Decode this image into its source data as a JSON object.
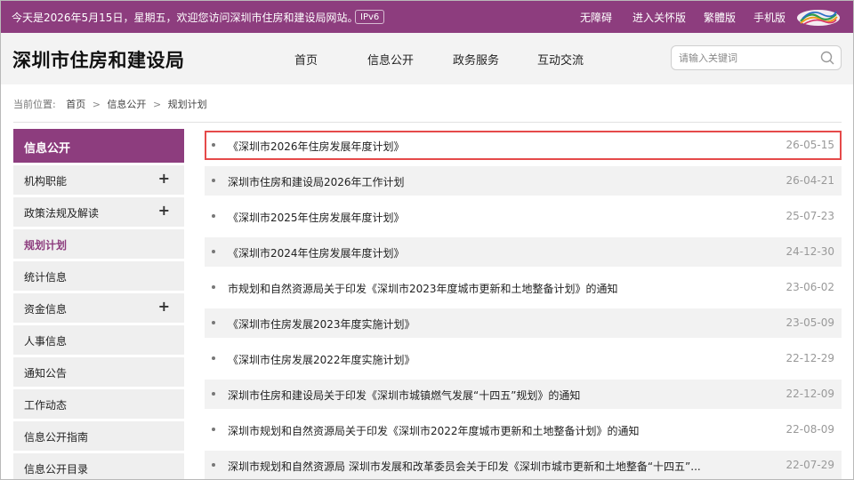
{
  "topbar": {
    "welcome": "今天是2026年5月15日，星期五，欢迎您访问深圳市住房和建设局网站。",
    "ipv6": "IPv6",
    "links": [
      "无障碍",
      "进入关怀版",
      "繁體版",
      "手机版"
    ]
  },
  "header": {
    "site_title": "深圳市住房和建设局",
    "nav": [
      "首页",
      "信息公开",
      "政务服务",
      "互动交流"
    ],
    "search_placeholder": "请输入关键词"
  },
  "breadcrumb": {
    "prefix": "当前位置:",
    "items": [
      "首页",
      "信息公开",
      "规划计划"
    ]
  },
  "sidebar": {
    "header": "信息公开",
    "items": [
      {
        "label": "机构职能",
        "expandable": true,
        "expand": "+"
      },
      {
        "label": "政策法规及解读",
        "expandable": true,
        "expand": "+"
      },
      {
        "label": "规划计划",
        "active": true
      },
      {
        "label": "统计信息"
      },
      {
        "label": "资金信息",
        "expandable": true,
        "expand": "+"
      },
      {
        "label": "人事信息"
      },
      {
        "label": "通知公告"
      },
      {
        "label": "工作动态"
      },
      {
        "label": "信息公开指南"
      },
      {
        "label": "信息公开目录"
      }
    ]
  },
  "articles": [
    {
      "title": "《深圳市2026年住房发展年度计划》",
      "date": "26-05-15",
      "highlighted": true
    },
    {
      "title": "深圳市住房和建设局2026年工作计划",
      "date": "26-04-21"
    },
    {
      "title": "《深圳市2025年住房发展年度计划》",
      "date": "25-07-23"
    },
    {
      "title": "《深圳市2024年住房发展年度计划》",
      "date": "24-12-30"
    },
    {
      "title": "市规划和自然资源局关于印发《深圳市2023年度城市更新和土地整备计划》的通知",
      "date": "23-06-02"
    },
    {
      "title": "《深圳市住房发展2023年度实施计划》",
      "date": "23-05-09"
    },
    {
      "title": "《深圳市住房发展2022年度实施计划》",
      "date": "22-12-29"
    },
    {
      "title": "深圳市住房和建设局关于印发《深圳市城镇燃气发展“十四五”规划》的通知",
      "date": "22-12-09"
    },
    {
      "title": "深圳市规划和自然资源局关于印发《深圳市2022年度城市更新和土地整备计划》的通知",
      "date": "22-08-09"
    },
    {
      "title": "深圳市规划和自然资源局 深圳市发展和改革委员会关于印发《深圳市城市更新和土地整备“十四五”...",
      "date": "22-07-29"
    }
  ],
  "colors": {
    "brand": "#8d3d7e",
    "highlight_border": "#e54a4a"
  },
  "icons": [
    "search-icon",
    "site-logo-icon",
    "bullet-icon",
    "plus-icon"
  ]
}
